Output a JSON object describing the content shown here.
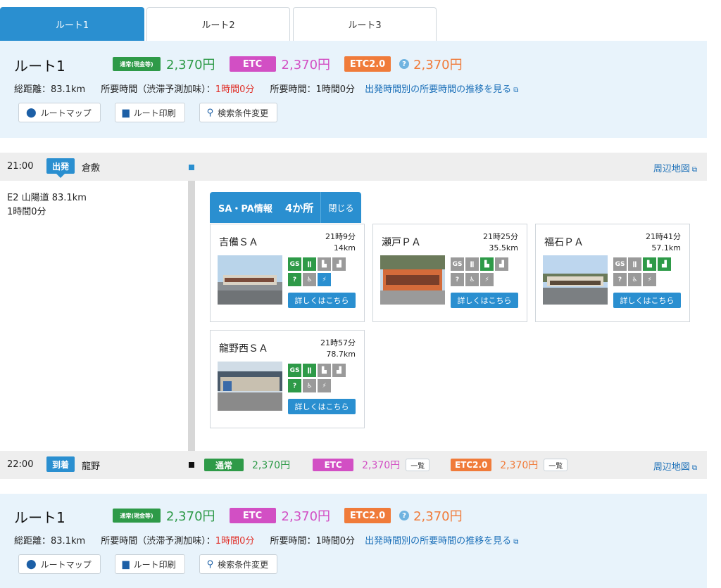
{
  "tabs": [
    {
      "label": "ルート1",
      "active": true
    },
    {
      "label": "ルート2",
      "active": false
    },
    {
      "label": "ルート3",
      "active": false
    }
  ],
  "summary": {
    "title": "ルート1",
    "normal_badge": "通常(現金等)",
    "normal_price": "2,370円",
    "etc_badge": "ETC",
    "etc_price": "2,370円",
    "etc2_badge": "ETC2.0",
    "etc2_price": "2,370円",
    "distance": "総距離：83.1km",
    "time_traffic_label": "所要時間（渋滞予測加味）：",
    "time_traffic_value": "1時間0分",
    "time_label": "所要時間：1時間0分",
    "trend_link": "出発時間別の所要時間の推移を見る",
    "buttons": {
      "route_map": "ルートマップ",
      "route_print": "ルート印刷",
      "change_search": "検索条件変更"
    }
  },
  "depart": {
    "time": "21:00",
    "badge": "出発",
    "place": "倉敷",
    "map_link": "周辺地図"
  },
  "segment": {
    "road": "E2 山陽道 83.1km",
    "duration": "1時間0分"
  },
  "sapa": {
    "title": "SA・PA情報",
    "count": "4か所",
    "close": "閉じる",
    "detail_label": "詳しくはこちら",
    "items": [
      {
        "name": "吉備ＳＡ",
        "time": "21時9分",
        "distance": "14km"
      },
      {
        "name": "瀬戸ＰＡ",
        "time": "21時25分",
        "distance": "35.5km"
      },
      {
        "name": "福石ＰＡ",
        "time": "21時41分",
        "distance": "57.1km"
      },
      {
        "name": "龍野西ＳＡ",
        "time": "21時57分",
        "distance": "78.7km"
      }
    ]
  },
  "arrive": {
    "time": "22:00",
    "badge": "到着",
    "place": "龍野",
    "map_link": "周辺地図",
    "normal_badge": "通常",
    "normal_price": "2,370円",
    "etc_badge": "ETC",
    "etc_price": "2,370円",
    "etc2_badge": "ETC2.0",
    "etc2_price": "2,370円",
    "list_label": "一覧"
  },
  "colors": {
    "accent": "#2a8fd0",
    "green": "#2e9a48",
    "pink": "#d24fc4",
    "orange": "#f07b3a",
    "red": "#e0312a"
  }
}
